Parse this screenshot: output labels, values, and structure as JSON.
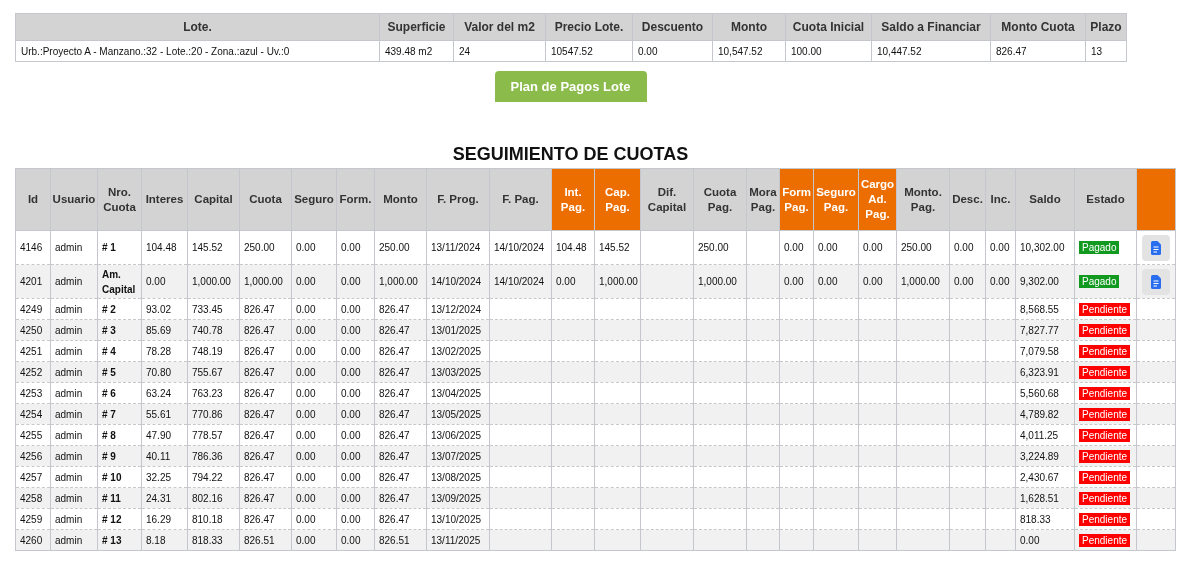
{
  "lote_table": {
    "columns": [
      "Lote.",
      "Superficie",
      "Valor del m2",
      "Precio Lote.",
      "Descuento",
      "Monto",
      "Cuota Inicial",
      "Saldo a Financiar",
      "Monto Cuota",
      "Plazo"
    ],
    "row": [
      "Urb.:Proyecto A - Manzano.:32 - Lote.:20 - Zona.:azul - Uv.:0",
      "439.48 m2",
      "24",
      "10547.52",
      "0.00",
      "10,547.52",
      "100.00",
      "10,447.52",
      "826.47",
      "13"
    ]
  },
  "plan_button": "Plan de Pagos Lote",
  "section_title": "SEGUIMIENTO DE CUOTAS",
  "cuotas_table": {
    "columns": [
      {
        "label": "Id",
        "highlighted": false
      },
      {
        "label": "Usuario",
        "highlighted": false
      },
      {
        "label": "Nro. Cuota",
        "highlighted": false
      },
      {
        "label": "Interes",
        "highlighted": false
      },
      {
        "label": "Capital",
        "highlighted": false
      },
      {
        "label": "Cuota",
        "highlighted": false
      },
      {
        "label": "Seguro",
        "highlighted": false
      },
      {
        "label": "Form.",
        "highlighted": false
      },
      {
        "label": "Monto",
        "highlighted": false
      },
      {
        "label": "F. Prog.",
        "highlighted": false
      },
      {
        "label": "F. Pag.",
        "highlighted": false
      },
      {
        "label": "Int. Pag.",
        "highlighted": true
      },
      {
        "label": "Cap. Pag.",
        "highlighted": true
      },
      {
        "label": "Dif. Capital",
        "highlighted": false
      },
      {
        "label": "Cuota Pag.",
        "highlighted": false
      },
      {
        "label": "Mora Pag.",
        "highlighted": false
      },
      {
        "label": "Form Pag.",
        "highlighted": true
      },
      {
        "label": "Seguro Pag.",
        "highlighted": true
      },
      {
        "label": "Cargo Ad. Pag.",
        "highlighted": true
      },
      {
        "label": "Monto. Pag.",
        "highlighted": false
      },
      {
        "label": "Desc.",
        "highlighted": false
      },
      {
        "label": "Inc.",
        "highlighted": false
      },
      {
        "label": "Saldo",
        "highlighted": false
      },
      {
        "label": "Estado",
        "highlighted": false
      },
      {
        "highlighted": true
      }
    ],
    "rows": [
      {
        "cells": [
          "4146",
          "admin",
          "# 1",
          "104.48",
          "145.52",
          "250.00",
          "0.00",
          "0.00",
          "250.00",
          "13/11/2024",
          "14/10/2024",
          "104.48",
          "145.52",
          null,
          "250.00",
          null,
          "0.00",
          "0.00",
          "0.00",
          "250.00",
          "0.00",
          "0.00",
          "10,302.00"
        ],
        "status": {
          "kind": "paid",
          "label": "Pagado"
        },
        "receipt_button": true
      },
      {
        "cells": [
          "4201",
          "admin",
          "Am. Capital",
          "0.00",
          "1,000.00",
          "1,000.00",
          "0.00",
          "0.00",
          "1,000.00",
          "14/10/2024",
          "14/10/2024",
          "0.00",
          "1,000.00",
          null,
          "1,000.00",
          null,
          "0.00",
          "0.00",
          "0.00",
          "1,000.00",
          "0.00",
          "0.00",
          "9,302.00"
        ],
        "status": {
          "kind": "paid",
          "label": "Pagado"
        },
        "receipt_button": true
      },
      {
        "cells": [
          "4249",
          "admin",
          "# 2",
          "93.02",
          "733.45",
          "826.47",
          "0.00",
          "0.00",
          "826.47",
          "13/12/2024",
          null,
          null,
          null,
          null,
          null,
          null,
          null,
          null,
          null,
          null,
          null,
          null,
          "8,568.55"
        ],
        "status": {
          "kind": "pending",
          "label": "Pendiente"
        },
        "receipt_button": false
      },
      {
        "cells": [
          "4250",
          "admin",
          "# 3",
          "85.69",
          "740.78",
          "826.47",
          "0.00",
          "0.00",
          "826.47",
          "13/01/2025",
          null,
          null,
          null,
          null,
          null,
          null,
          null,
          null,
          null,
          null,
          null,
          null,
          "7,827.77"
        ],
        "status": {
          "kind": "pending",
          "label": "Pendiente"
        },
        "receipt_button": false
      },
      {
        "cells": [
          "4251",
          "admin",
          "# 4",
          "78.28",
          "748.19",
          "826.47",
          "0.00",
          "0.00",
          "826.47",
          "13/02/2025",
          null,
          null,
          null,
          null,
          null,
          null,
          null,
          null,
          null,
          null,
          null,
          null,
          "7,079.58"
        ],
        "status": {
          "kind": "pending",
          "label": "Pendiente"
        },
        "receipt_button": false
      },
      {
        "cells": [
          "4252",
          "admin",
          "# 5",
          "70.80",
          "755.67",
          "826.47",
          "0.00",
          "0.00",
          "826.47",
          "13/03/2025",
          null,
          null,
          null,
          null,
          null,
          null,
          null,
          null,
          null,
          null,
          null,
          null,
          "6,323.91"
        ],
        "status": {
          "kind": "pending",
          "label": "Pendiente"
        },
        "receipt_button": false
      },
      {
        "cells": [
          "4253",
          "admin",
          "# 6",
          "63.24",
          "763.23",
          "826.47",
          "0.00",
          "0.00",
          "826.47",
          "13/04/2025",
          null,
          null,
          null,
          null,
          null,
          null,
          null,
          null,
          null,
          null,
          null,
          null,
          "5,560.68"
        ],
        "status": {
          "kind": "pending",
          "label": "Pendiente"
        },
        "receipt_button": false
      },
      {
        "cells": [
          "4254",
          "admin",
          "# 7",
          "55.61",
          "770.86",
          "826.47",
          "0.00",
          "0.00",
          "826.47",
          "13/05/2025",
          null,
          null,
          null,
          null,
          null,
          null,
          null,
          null,
          null,
          null,
          null,
          null,
          "4,789.82"
        ],
        "status": {
          "kind": "pending",
          "label": "Pendiente"
        },
        "receipt_button": false
      },
      {
        "cells": [
          "4255",
          "admin",
          "# 8",
          "47.90",
          "778.57",
          "826.47",
          "0.00",
          "0.00",
          "826.47",
          "13/06/2025",
          null,
          null,
          null,
          null,
          null,
          null,
          null,
          null,
          null,
          null,
          null,
          null,
          "4,011.25"
        ],
        "status": {
          "kind": "pending",
          "label": "Pendiente"
        },
        "receipt_button": false
      },
      {
        "cells": [
          "4256",
          "admin",
          "# 9",
          "40.11",
          "786.36",
          "826.47",
          "0.00",
          "0.00",
          "826.47",
          "13/07/2025",
          null,
          null,
          null,
          null,
          null,
          null,
          null,
          null,
          null,
          null,
          null,
          null,
          "3,224.89"
        ],
        "status": {
          "kind": "pending",
          "label": "Pendiente"
        },
        "receipt_button": false
      },
      {
        "cells": [
          "4257",
          "admin",
          "# 10",
          "32.25",
          "794.22",
          "826.47",
          "0.00",
          "0.00",
          "826.47",
          "13/08/2025",
          null,
          null,
          null,
          null,
          null,
          null,
          null,
          null,
          null,
          null,
          null,
          null,
          "2,430.67"
        ],
        "status": {
          "kind": "pending",
          "label": "Pendiente"
        },
        "receipt_button": false
      },
      {
        "cells": [
          "4258",
          "admin",
          "# 11",
          "24.31",
          "802.16",
          "826.47",
          "0.00",
          "0.00",
          "826.47",
          "13/09/2025",
          null,
          null,
          null,
          null,
          null,
          null,
          null,
          null,
          null,
          null,
          null,
          null,
          "1,628.51"
        ],
        "status": {
          "kind": "pending",
          "label": "Pendiente"
        },
        "receipt_button": false
      },
      {
        "cells": [
          "4259",
          "admin",
          "# 12",
          "16.29",
          "810.18",
          "826.47",
          "0.00",
          "0.00",
          "826.47",
          "13/10/2025",
          null,
          null,
          null,
          null,
          null,
          null,
          null,
          null,
          null,
          null,
          null,
          null,
          "818.33"
        ],
        "status": {
          "kind": "pending",
          "label": "Pendiente"
        },
        "receipt_button": false
      },
      {
        "cells": [
          "4260",
          "admin",
          "# 13",
          "8.18",
          "818.33",
          "826.51",
          "0.00",
          "0.00",
          "826.51",
          "13/11/2025",
          null,
          null,
          null,
          null,
          null,
          null,
          null,
          null,
          null,
          null,
          null,
          null,
          "0.00"
        ],
        "status": {
          "kind": "pending",
          "label": "Pendiente"
        },
        "receipt_button": false
      }
    ]
  }
}
